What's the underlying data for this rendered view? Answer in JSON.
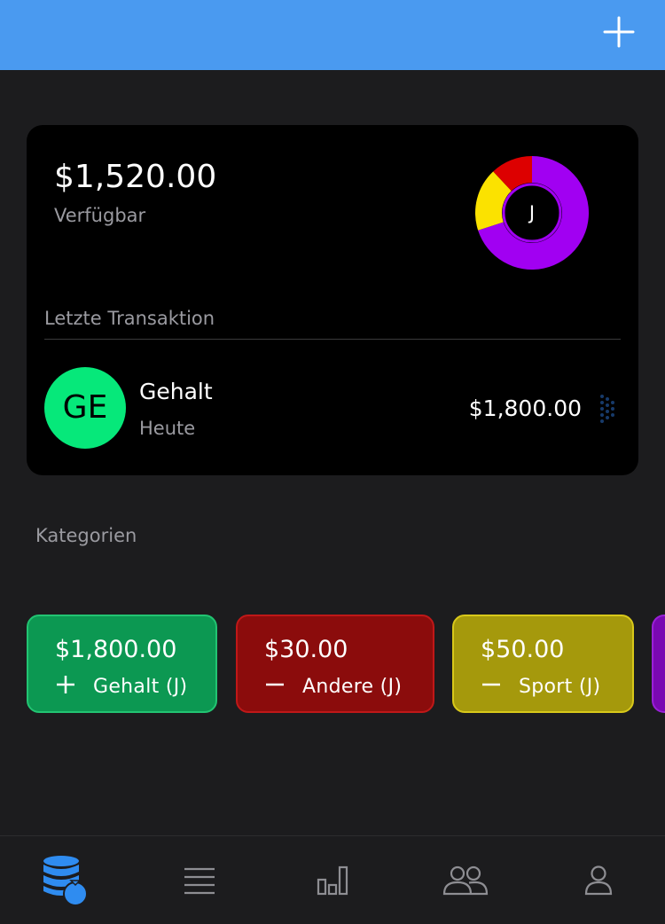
{
  "header": {
    "add_icon": "plus-icon",
    "color": "#4a9af0"
  },
  "summary": {
    "balance": "$1,520.00",
    "balance_label": "Verfügbar",
    "avatar_initial": "J",
    "donut": [
      {
        "category": "Gehalt",
        "fraction": 0.7,
        "color": "#a100f2"
      },
      {
        "category": "Sport",
        "fraction": 0.18,
        "color": "#fbe200"
      },
      {
        "category": "Andere",
        "fraction": 0.12,
        "color": "#dd0000"
      }
    ]
  },
  "last_transaction": {
    "section_title": "Letzte Transaktion",
    "initials": "GE",
    "name": "Gehalt",
    "date": "Heute",
    "amount": "$1,800.00",
    "avatar_color": "#06e87a"
  },
  "categories": {
    "section_title": "Kategorien",
    "items": [
      {
        "amount": "$1,800.00",
        "sign": "plus",
        "label": "Gehalt (J)",
        "color": "#0c9852",
        "border": "#22c472"
      },
      {
        "amount": "$30.00",
        "sign": "minus",
        "label": "Andere (J)",
        "color": "#8b0c0c",
        "border": "#c01818"
      },
      {
        "amount": "$50.00",
        "sign": "minus",
        "label": "Sport (J)",
        "color": "#a5990c",
        "border": "#d8c81a"
      },
      {
        "amount": "",
        "sign": "",
        "label": "",
        "color": "#7a08b2",
        "border": "#9a20d8"
      }
    ]
  },
  "nav": {
    "items": [
      {
        "icon": "money-stack-icon",
        "active": true
      },
      {
        "icon": "list-icon",
        "active": false
      },
      {
        "icon": "bar-chart-icon",
        "active": false
      },
      {
        "icon": "people-icon",
        "active": false
      },
      {
        "icon": "person-icon",
        "active": false
      }
    ],
    "active_color": "#2f8cf0",
    "inactive_color": "#8e8e93"
  }
}
